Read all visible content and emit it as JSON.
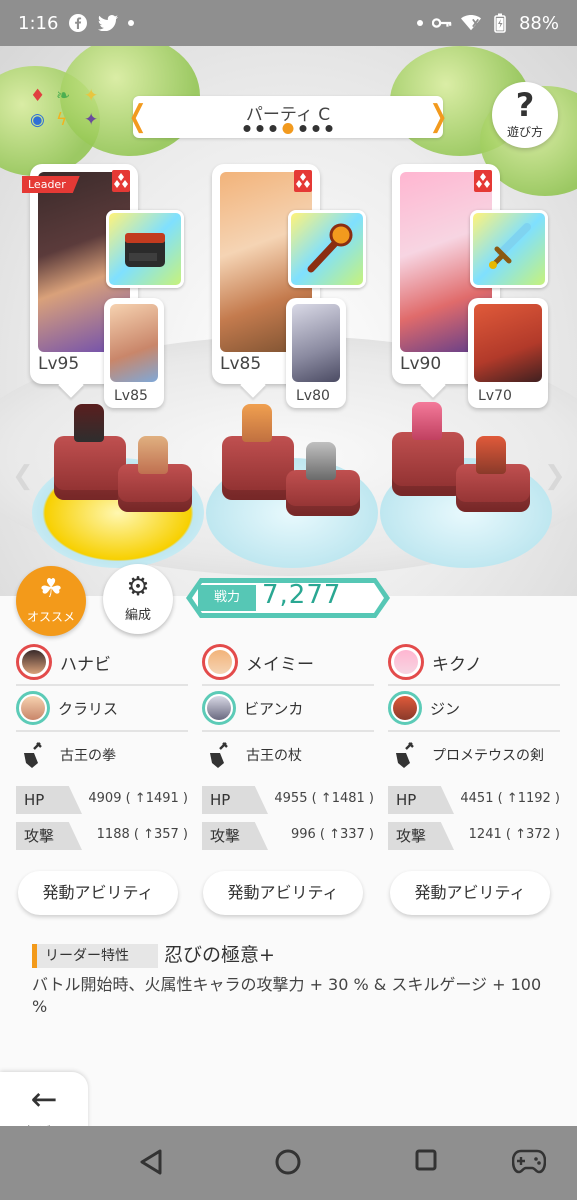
{
  "status_bar": {
    "time": "1:16",
    "battery": "88%"
  },
  "header": {
    "party_title": "パーティ C",
    "party_pages": 7,
    "party_active": 4,
    "help_label": "遊び方"
  },
  "cards": [
    {
      "leader_tag": "Leader",
      "main_lv": "Lv95",
      "sub_lv": "Lv85"
    },
    {
      "main_lv": "Lv85",
      "sub_lv": "Lv80"
    },
    {
      "main_lv": "Lv90",
      "sub_lv": "Lv70"
    }
  ],
  "buttons": {
    "osusume": "オススメ",
    "hensei": "編成"
  },
  "power": {
    "label": "戦力",
    "value": "7,277"
  },
  "units": [
    {
      "main": "ハナビ",
      "sub": "クラリス",
      "weapon": "古王の拳",
      "hp": "4909 ( ↑1491 )",
      "atk": "1188 ( ↑357 )",
      "ability": "発動アビリティ"
    },
    {
      "main": "メイミー",
      "sub": "ビアンカ",
      "weapon": "古王の杖",
      "hp": "4955 ( ↑1481 )",
      "atk": "996 ( ↑337 )",
      "ability": "発動アビリティ"
    },
    {
      "main": "キクノ",
      "sub": "ジン",
      "weapon": "プロメテウスの剣",
      "hp": "4451 ( ↑1192 )",
      "atk": "1241 ( ↑372 )",
      "ability": "発動アビリティ"
    }
  ],
  "stat_labels": {
    "hp": "HP",
    "atk": "攻撃"
  },
  "leader_skill": {
    "label": "リーダー特性",
    "name": "忍びの極意+",
    "description": "バトル開始時、火属性キャラの攻撃力 + 30 % & スキルゲージ + 100 %"
  },
  "back": {
    "label": "もどる"
  },
  "colors": {
    "accent": "#f39a1a",
    "teal": "#56c7b5",
    "leader_red": "#e53935"
  }
}
